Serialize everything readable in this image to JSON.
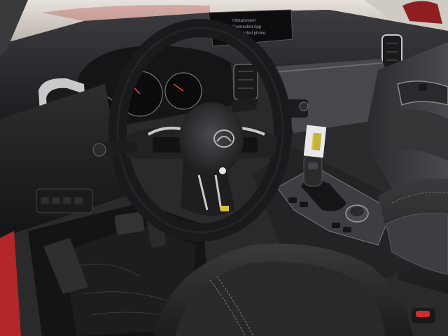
{
  "screen": {
    "lines": [
      "Infotainment",
      "Connected App",
      "Connected phone"
    ]
  },
  "colors": {
    "dash_dark": "#1f1f21",
    "dash_mid": "#3a3a3d",
    "dash_light": "#55555a",
    "chrome": "#c9c9cc",
    "seat": "#262628",
    "seat_stitch": "#6e6e72",
    "windshield": "#d9d4cf",
    "red_accent": "#c9302c",
    "tag_yellow": "#d8c23a"
  }
}
